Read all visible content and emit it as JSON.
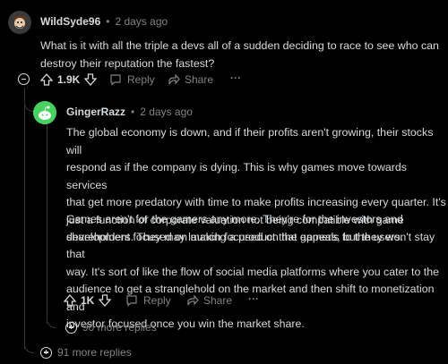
{
  "comment": {
    "username": "WildSyde96",
    "separator": "•",
    "time": "2 days ago",
    "text_lines": [
      "What is it with all the triple a devs all of a sudden deciding to race to see who can",
      "destroy their reputation the fastest?"
    ],
    "votes": "1.9K",
    "reply_label": "Reply",
    "share_label": "Share",
    "more_label": "···"
  },
  "reply": {
    "username": "GingerRazz",
    "separator": "•",
    "time": "2 days ago",
    "paragraph1_lines": [
      "The global economy is down, and if their profits aren't growing, their stocks will",
      "respond as if the company is dying. This is why games move towards services",
      "that get more predatory with time to make profits increasing every quarter. It's",
      "just a function of corporate valuation not being compatible with game",
      "development focused on making a product that appeals to the users."
    ],
    "paragraph2_lines": [
      "Games aren't for the gamers any more. They're for the investors and",
      "shareholders. They may launch focused on the gamers, but they won't stay that",
      "way. It's sort of like the flow of social media platforms where you cater to the",
      "audience to get a stranglehold on the market and then shift to monetization and",
      "investor focused once you win the market share."
    ],
    "votes": "1K",
    "reply_label": "Reply",
    "share_label": "Share",
    "more_label": "···"
  },
  "more_replies_inner": "90 more replies",
  "more_replies_outer": "91 more replies",
  "colors": {
    "background": "#000000",
    "text": "#d7dadc",
    "muted": "#818384",
    "thread_line": "#343536",
    "reply_avatar_green": "#46d160"
  }
}
